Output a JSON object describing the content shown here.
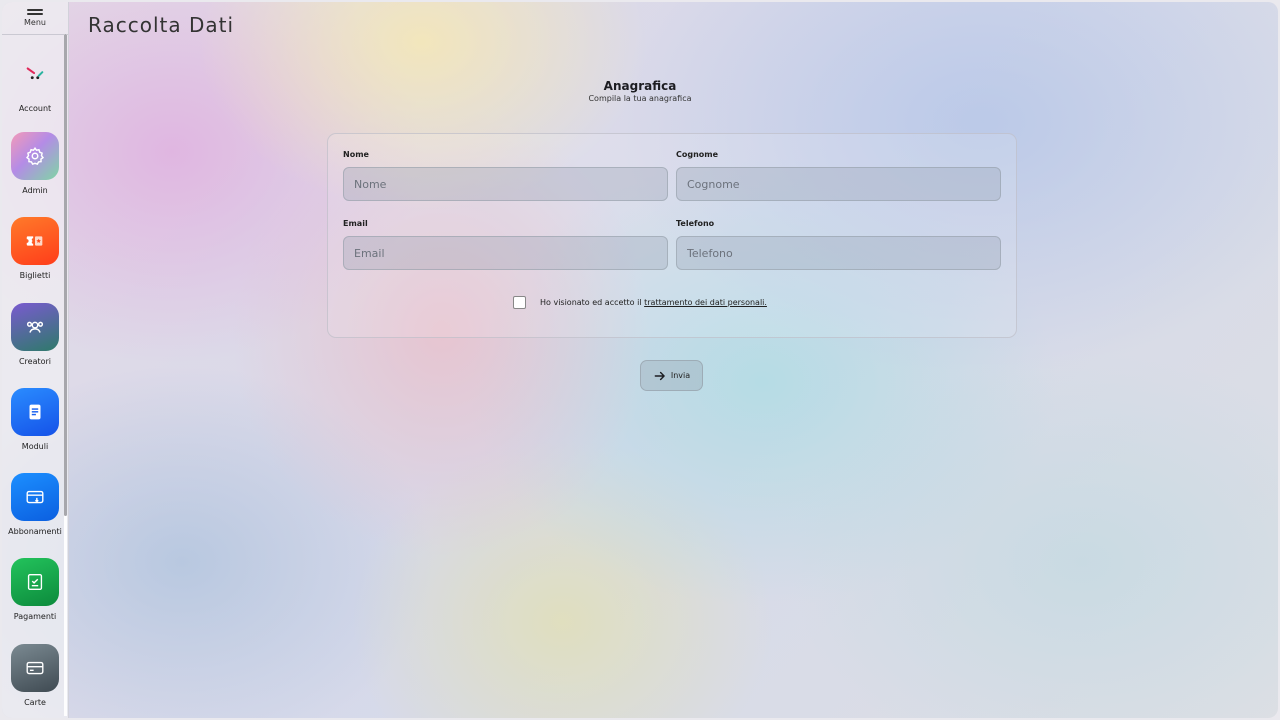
{
  "app": {
    "title": "Raccolta Dati"
  },
  "sidebar": {
    "menu_label": "Menu",
    "items": [
      {
        "label": "Account",
        "icon": "account-logo-icon",
        "color": ""
      },
      {
        "label": "Admin",
        "icon": "gear-icon",
        "color": "#b98ae0"
      },
      {
        "label": "Biglietti",
        "icon": "ticket-icon",
        "color": "#ff5a1f"
      },
      {
        "label": "Creatori",
        "icon": "users-icon",
        "color": "#6a4ab8"
      },
      {
        "label": "Moduli",
        "icon": "form-icon",
        "color": "#1a7bff"
      },
      {
        "label": "Abbonamenti",
        "icon": "subscription-card-icon",
        "color": "#1080ff"
      },
      {
        "label": "Pagamenti",
        "icon": "receipt-check-icon",
        "color": "#11a34a"
      },
      {
        "label": "Carte",
        "icon": "card-icon",
        "color": "#5e6b73"
      }
    ]
  },
  "section": {
    "title": "Anagrafica",
    "subtitle": "Compila la tua anagrafica"
  },
  "form": {
    "nome_label": "Nome",
    "nome_placeholder": "Nome",
    "cognome_label": "Cognome",
    "cognome_placeholder": "Cognome",
    "email_label": "Email",
    "email_placeholder": "Email",
    "telefono_label": "Telefono",
    "telefono_placeholder": "Telefono",
    "consent_text": "Ho visionato ed accetto il ",
    "consent_link": "trattamento dei dati personali.",
    "consent_checked": false,
    "submit_label": "Invia"
  }
}
